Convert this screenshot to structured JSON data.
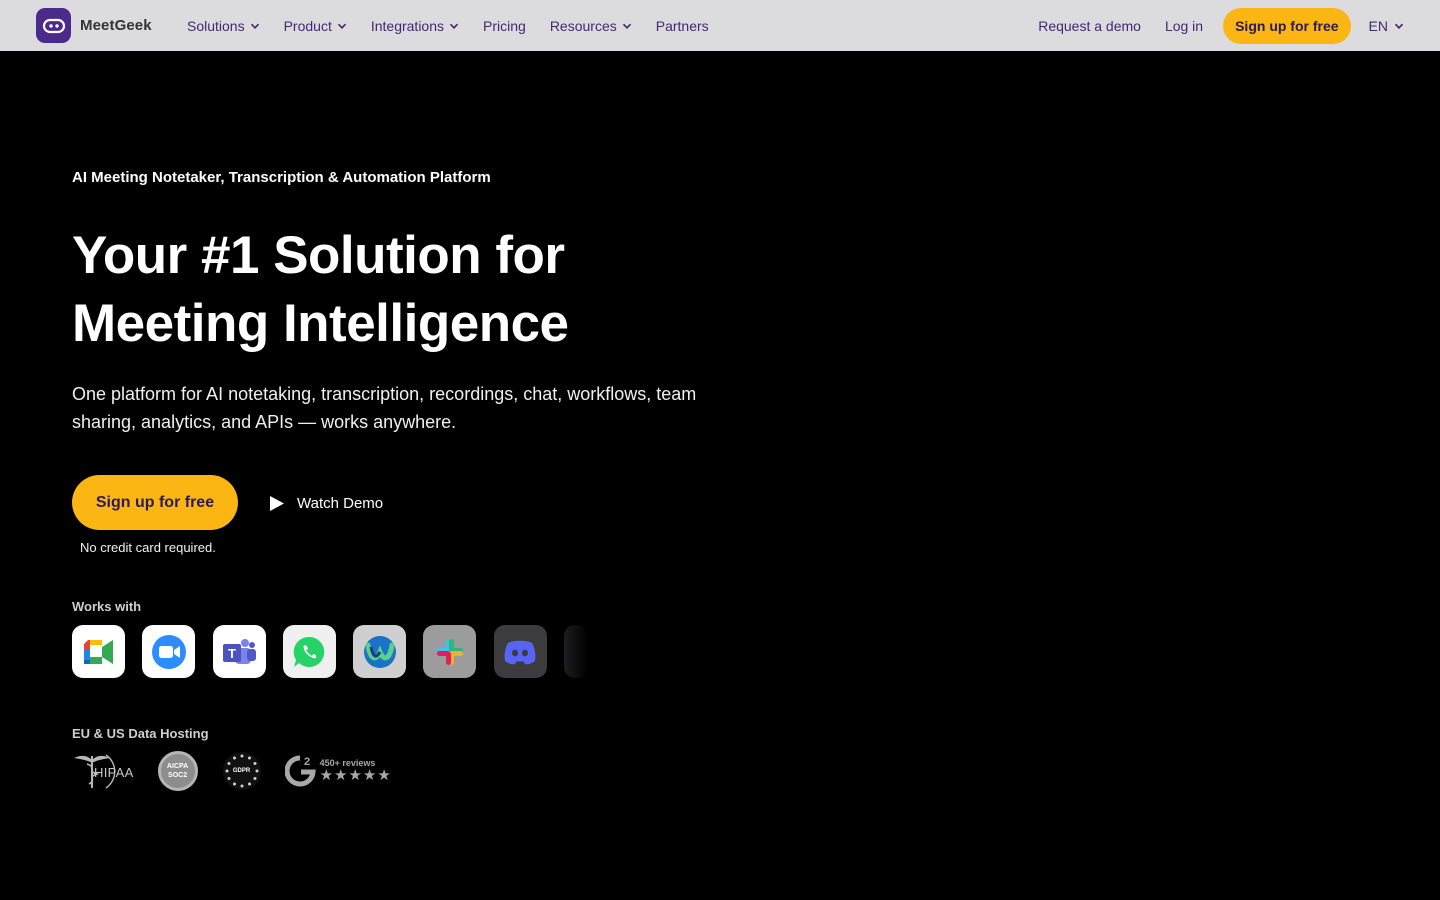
{
  "nav": {
    "brand": "MeetGeek",
    "menu": [
      {
        "label": "Solutions",
        "dropdown": true
      },
      {
        "label": "Product",
        "dropdown": true
      },
      {
        "label": "Integrations",
        "dropdown": true
      },
      {
        "label": "Pricing",
        "dropdown": false
      },
      {
        "label": "Resources",
        "dropdown": true
      },
      {
        "label": "Partners",
        "dropdown": false
      }
    ],
    "request_demo": "Request a demo",
    "login": "Log in",
    "signup": "Sign up for free",
    "language": "EN"
  },
  "hero": {
    "eyebrow": "AI Meeting Notetaker, Transcription & Automation Platform",
    "headline_line1": "Your #1 Solution for",
    "headline_line2": "Meeting Intelligence",
    "subtitle": "One platform for AI notetaking, transcription, recordings, chat, workflows, team sharing, analytics, and APIs — works anywhere.",
    "cta_primary": "Sign up for free",
    "cta_secondary": "Watch Demo",
    "note": "No credit card required."
  },
  "works_with": {
    "label": "Works with",
    "apps": [
      "google-meet-icon",
      "zoom-icon",
      "microsoft-teams-icon",
      "whatsapp-icon",
      "webex-icon",
      "slack-icon",
      "discord-icon",
      "more-app-icon"
    ]
  },
  "compliance": {
    "label": "EU & US Data Hosting",
    "hipaa": "HIPAA",
    "aicpa_line1": "AICPA",
    "aicpa_line2": "SOC2",
    "gdpr": "GDPR",
    "g2_reviews": "450+ reviews",
    "g2_stars": "★★★★★"
  },
  "colors": {
    "accent": "#fbb614",
    "nav_bg": "#dcdcdf",
    "nav_text": "#3d2b72",
    "brand_purple": "#4b2a8c"
  }
}
